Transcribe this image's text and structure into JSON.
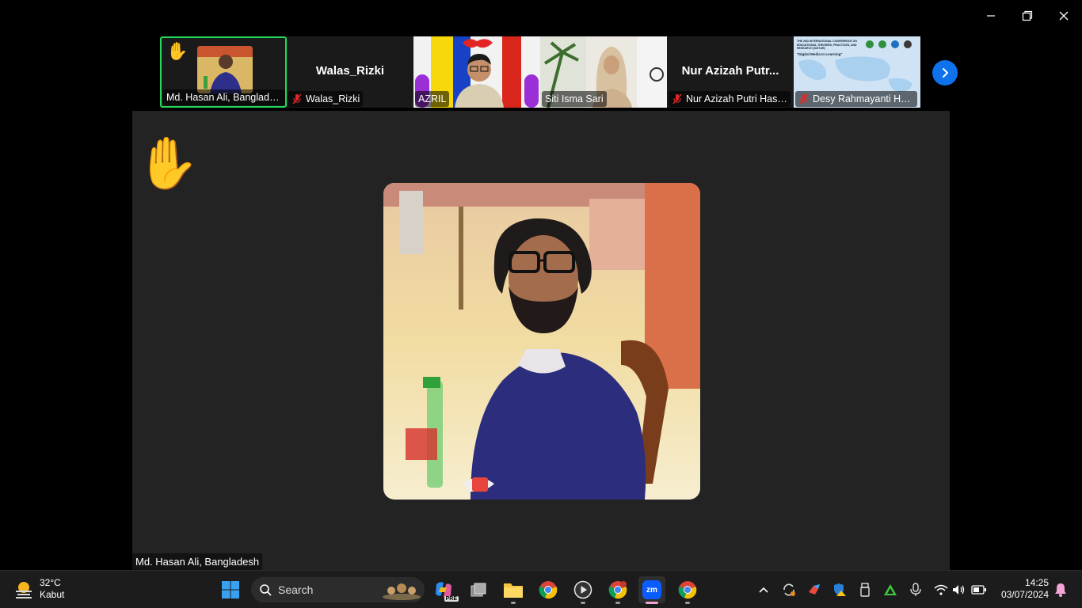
{
  "window": {
    "minimize_label": "Minimize",
    "restore_label": "Restore",
    "close_label": "Close"
  },
  "participants": [
    {
      "name": "Md. Hasan Ali, Banglade...",
      "muted": false,
      "hand_raised": true,
      "active": true
    },
    {
      "name": "Walas_Rizki",
      "big_name": "Walas_Rizki",
      "muted": true
    },
    {
      "name": "AZRIL",
      "muted": false
    },
    {
      "name": "Siti Isma Sari",
      "muted": false
    },
    {
      "name": "Nur Azizah Putri Hasi...",
      "big_name": "Nur Azizah Putr...",
      "muted": true
    },
    {
      "name": "Desy Rahmayanti Has...",
      "muted": true,
      "slide_title": "THE 2ND INTERNATIONAL CONFERENCE ON EDUCATIONAL THEORIES, PRACTICES, AND RESEARCH (ICETAR)",
      "slide_subtitle": "\"Digital Media In Learning\""
    }
  ],
  "stage": {
    "speaker_name": "Md. Hasan Ali, Bangladesh"
  },
  "taskbar": {
    "weather": {
      "temp": "32°C",
      "condition": "Kabut"
    },
    "search_label": "Search",
    "pre_badge": "PRE",
    "zoom_label": "zm",
    "clock": {
      "time": "14:25",
      "date": "03/07/2024"
    }
  },
  "colors": {
    "active_border": "#23d959",
    "accent": "#0e72ed",
    "mute": "#e02828"
  }
}
